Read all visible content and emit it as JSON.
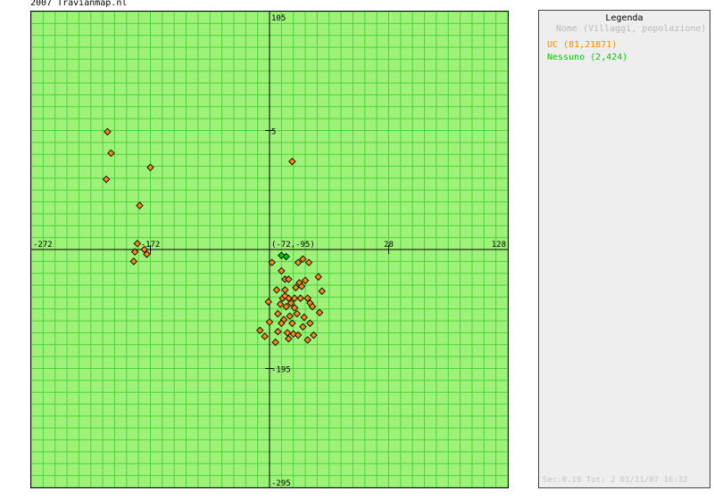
{
  "header": {
    "title": "2007 Travianmap.nl"
  },
  "map": {
    "colors": {
      "background": "#9ef27a",
      "grid": "#4fd33a",
      "axis": "#000000",
      "village_uc": "#ff8c00",
      "village_nessuno": "#00cc00",
      "marker_outline": "#000000"
    },
    "x_range": [
      -272,
      128
    ],
    "y_range": [
      -295,
      105
    ],
    "grid_step": 10,
    "axis_labels": {
      "x": [
        "-272",
        "-172",
        "28",
        "128"
      ],
      "y": [
        "105",
        "5",
        "-195",
        "-295"
      ],
      "center": "(-72,-95)"
    },
    "villages": {
      "uc": [
        [
          -208,
          4
        ],
        [
          -205,
          -14
        ],
        [
          -209,
          -36
        ],
        [
          -172,
          -26
        ],
        [
          -181,
          -58
        ],
        [
          -183,
          -90
        ],
        [
          -185,
          -97
        ],
        [
          -186,
          -105
        ],
        [
          -175,
          -99
        ],
        [
          -177,
          -95
        ],
        [
          -53,
          -21
        ],
        [
          -48,
          -106
        ],
        [
          -39,
          -106
        ],
        [
          -44,
          -103
        ],
        [
          -42,
          -121
        ],
        [
          -70,
          -106
        ],
        [
          -62,
          -113
        ],
        [
          -59,
          -120
        ],
        [
          -56,
          -120
        ],
        [
          -59,
          -129
        ],
        [
          -61,
          -136
        ],
        [
          -56,
          -136
        ],
        [
          -51,
          -136
        ],
        [
          -46,
          -136
        ],
        [
          -40,
          -136
        ],
        [
          -66,
          -129
        ],
        [
          -63,
          -141
        ],
        [
          -73,
          -139
        ],
        [
          -58,
          -143
        ],
        [
          -51,
          -144
        ],
        [
          -49,
          -149
        ],
        [
          -43,
          -152
        ],
        [
          -38,
          -140
        ],
        [
          -36,
          -143
        ],
        [
          -53,
          -157
        ],
        [
          -44,
          -160
        ],
        [
          -38,
          -157
        ],
        [
          -65,
          -149
        ],
        [
          -60,
          -154
        ],
        [
          -55,
          -151
        ],
        [
          -65,
          -164
        ],
        [
          -72,
          -156
        ],
        [
          -76,
          -168
        ],
        [
          -67,
          -173
        ],
        [
          -80,
          -163
        ],
        [
          -52,
          -166
        ],
        [
          -56,
          -170
        ],
        [
          -48,
          -167
        ],
        [
          -40,
          -171
        ],
        [
          -35,
          -167
        ],
        [
          -62,
          -157
        ],
        [
          -54,
          -140
        ],
        [
          -59,
          -134
        ],
        [
          -47,
          -123
        ],
        [
          -31,
          -118
        ],
        [
          -28,
          -130
        ],
        [
          -30,
          -148
        ],
        [
          -45,
          -126
        ],
        [
          -50,
          -127
        ],
        [
          -57,
          -165
        ]
      ],
      "nessuno": [
        [
          -62,
          -100
        ],
        [
          -58,
          -101
        ]
      ]
    }
  },
  "legend": {
    "title": "Legenda",
    "subtitle": "Nome (Villaggi, popolazione)",
    "entries": [
      {
        "label": "UC (81,21871)",
        "color": "#ff8c00"
      },
      {
        "label": "Nessuno (2,424)",
        "color": "#00cc00"
      }
    ],
    "footer": "Sec:0.19 Tot: 2 01/11/07 16:32"
  }
}
